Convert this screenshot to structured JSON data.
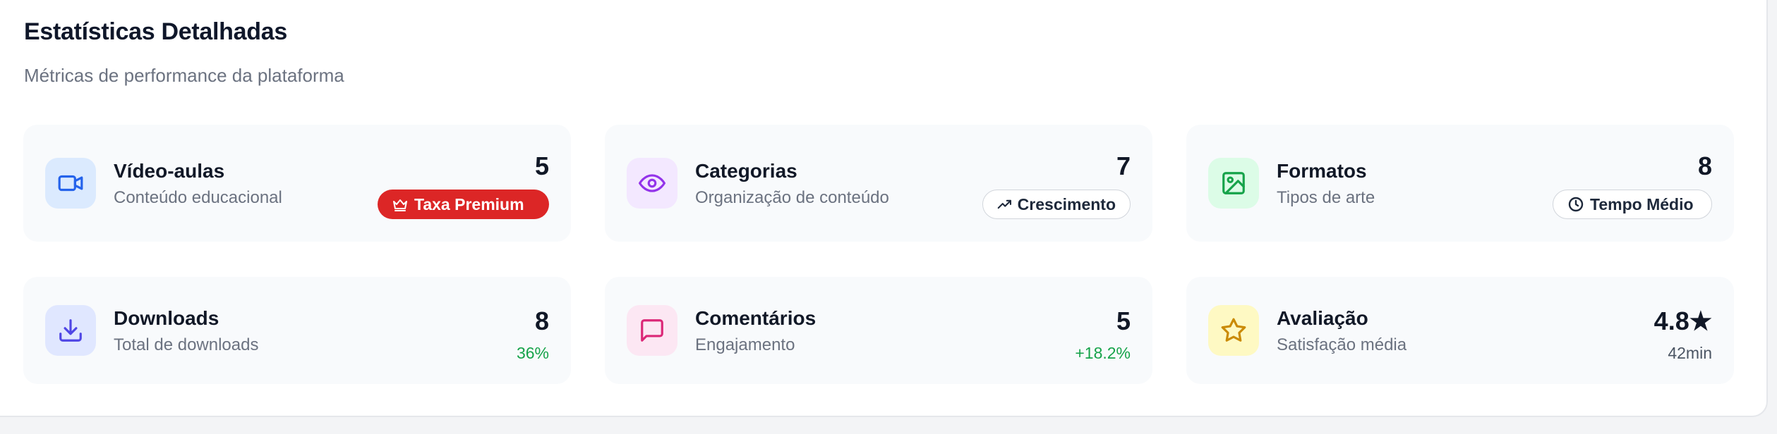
{
  "header": {
    "title": "Estatísticas Detalhadas",
    "subtitle": "Métricas de performance da plataforma"
  },
  "cards": [
    {
      "name": "Vídeo-aulas",
      "description": "Conteúdo educacional",
      "value": "5",
      "badge": "Taxa Premium",
      "icon": "video-icon",
      "badge_icon": "crown-icon",
      "icon_color": "#2563eb",
      "icon_bg": "#dbeafe"
    },
    {
      "name": "Categorias",
      "description": "Organização de conteúdo",
      "value": "7",
      "badge": "Crescimento",
      "icon": "eye-icon",
      "badge_icon": "trending-up-icon",
      "icon_color": "#9333ea",
      "icon_bg": "#f3e8ff"
    },
    {
      "name": "Formatos",
      "description": "Tipos de arte",
      "value": "8",
      "badge": "Tempo Médio",
      "icon": "image-icon",
      "badge_icon": "clock-icon",
      "icon_color": "#16a34a",
      "icon_bg": "#dcfce7"
    },
    {
      "name": "Downloads",
      "description": "Total de downloads",
      "value": "8",
      "sub_value": "36%",
      "icon": "download-icon",
      "icon_color": "#4f46e5",
      "icon_bg": "#e0e7ff"
    },
    {
      "name": "Comentários",
      "description": "Engajamento",
      "value": "5",
      "sub_value": "+18.2%",
      "icon": "message-icon",
      "icon_color": "#db2777",
      "icon_bg": "#fce7f3"
    },
    {
      "name": "Avaliação",
      "description": "Satisfação média",
      "value": "4.8★",
      "sub_value": "42min",
      "icon": "star-icon",
      "icon_color": "#ca8a04",
      "icon_bg": "#fef9c3"
    }
  ],
  "colors": {
    "badge_red": "#dc2626",
    "positive": "#16a34a",
    "card_bg": "#f8fafc"
  }
}
